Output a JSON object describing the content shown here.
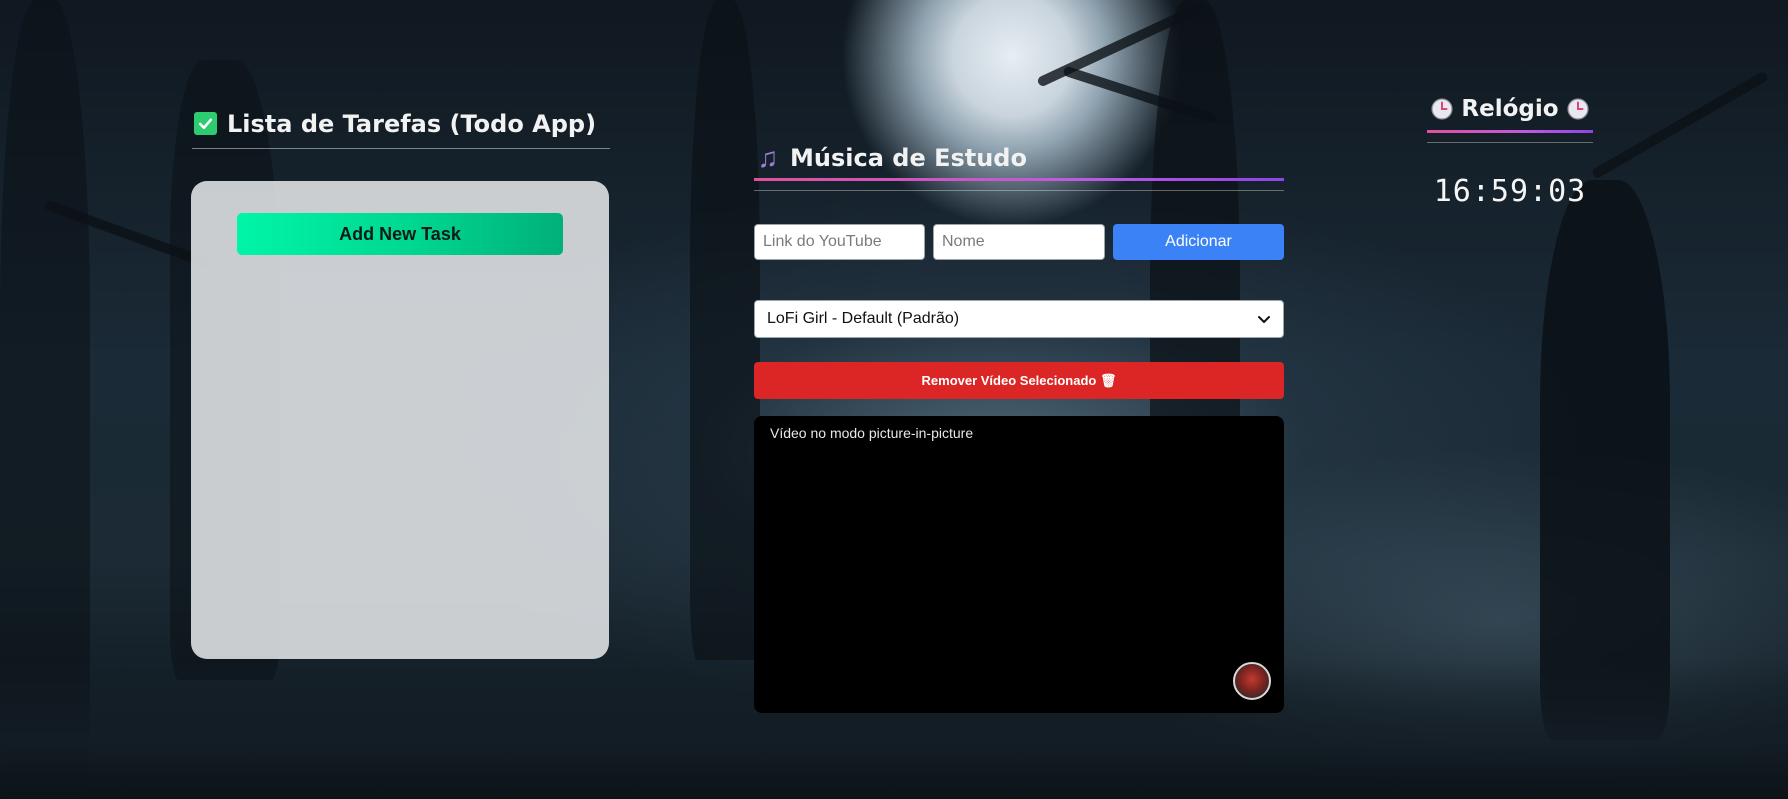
{
  "todo": {
    "title": "Lista de Tarefas (Todo App)",
    "add_button_label": "Add New Task"
  },
  "music": {
    "title": "Música de Estudo",
    "youtube_input": {
      "placeholder": "Link do YouTube",
      "value": ""
    },
    "name_input": {
      "placeholder": "Nome",
      "value": ""
    },
    "add_button_label": "Adicionar",
    "selected_video": "LoFi Girl - Default (Padrão)",
    "remove_button_label": "Remover Vídeo Selecionado 🗑",
    "video_status": "Vídeo no modo picture-in-picture"
  },
  "clock": {
    "title": "Relógio",
    "time": "16:59:03"
  },
  "icons": {
    "todo": "check-box-icon",
    "music": "music-note-icon",
    "clock": "clock-icon",
    "select": "chevron-down-icon"
  },
  "colors": {
    "add_task_green": "#00d68f",
    "add_blue": "#3b82f6",
    "remove_red": "#dc2626",
    "underline_pink": "#e0529c",
    "underline_purple": "#8f44e8",
    "checkbox_green": "#2ecc71",
    "note_purple": "#9b7cd6"
  }
}
